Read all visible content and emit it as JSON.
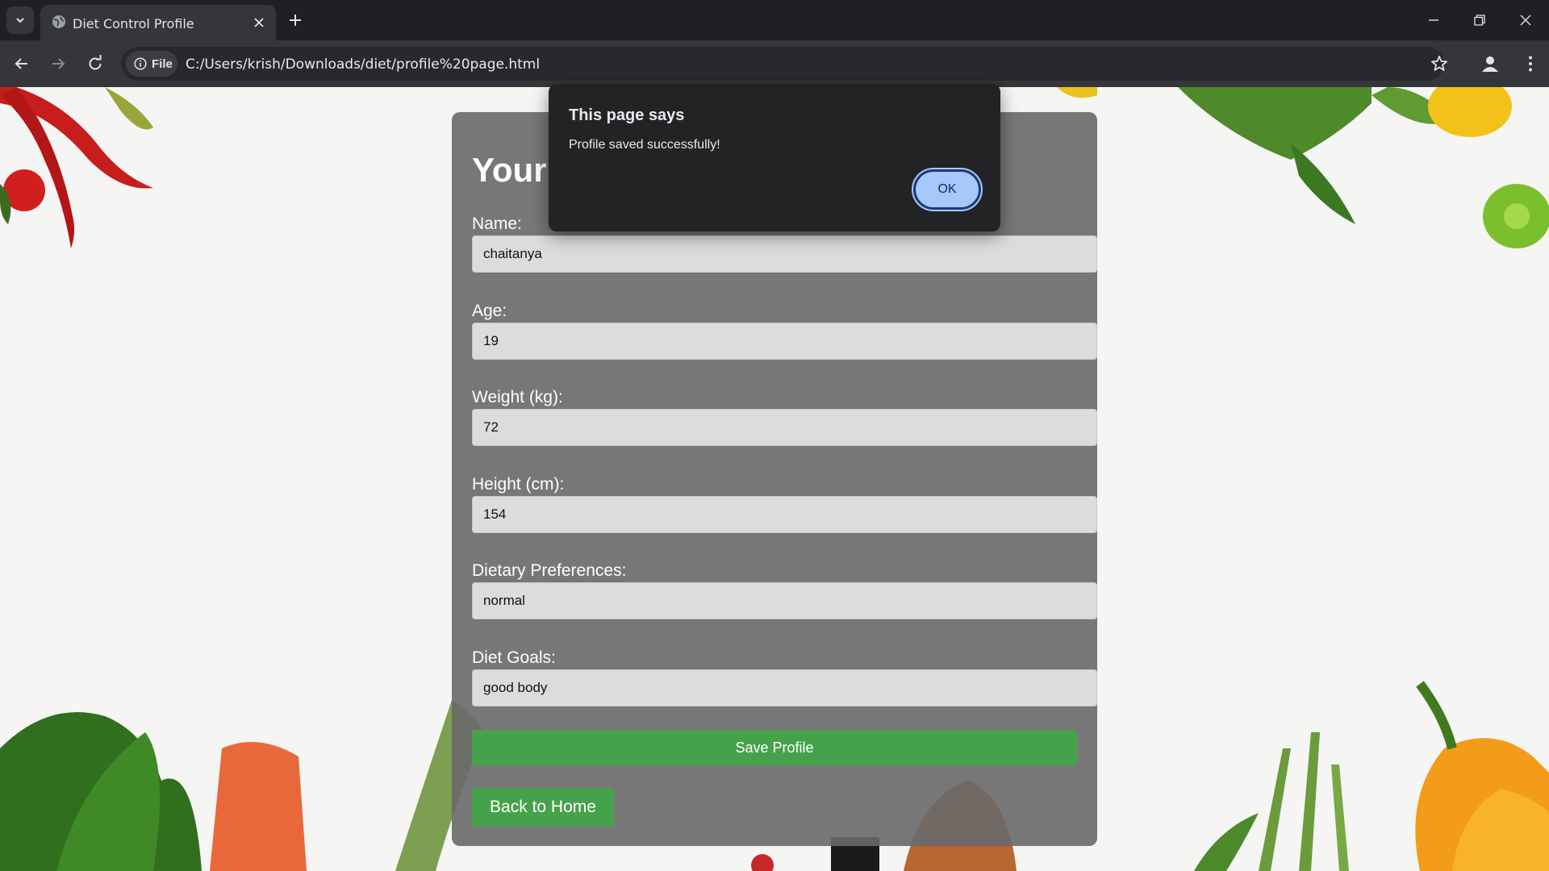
{
  "browser": {
    "tab_title": "Diet Control Profile",
    "site_chip": "File",
    "url": "C:/Users/krish/Downloads/diet/profile%20page.html"
  },
  "page": {
    "heading": "Your",
    "fields": [
      {
        "label": "Name:",
        "value": "chaitanya"
      },
      {
        "label": "Age:",
        "value": "19"
      },
      {
        "label": "Weight (kg):",
        "value": "72"
      },
      {
        "label": "Height (cm):",
        "value": "154"
      },
      {
        "label": "Dietary Preferences:",
        "value": "normal"
      },
      {
        "label": "Diet Goals:",
        "value": "good body"
      }
    ],
    "save_button": "Save Profile",
    "home_button": "Back to Home"
  },
  "dialog": {
    "title": "This page says",
    "message": "Profile saved successfully!",
    "ok_label": "OK"
  },
  "colors": {
    "button_green": "#46a24a",
    "dialog_ok_bg": "#a8c7fa",
    "card_bg": "#696969"
  },
  "icons": [
    "tab-list-icon",
    "globe-icon",
    "close-icon",
    "plus-icon",
    "minimize-icon",
    "restore-icon",
    "back-icon",
    "forward-icon",
    "reload-icon",
    "info-icon",
    "star-icon",
    "profile-icon",
    "more-icon"
  ]
}
